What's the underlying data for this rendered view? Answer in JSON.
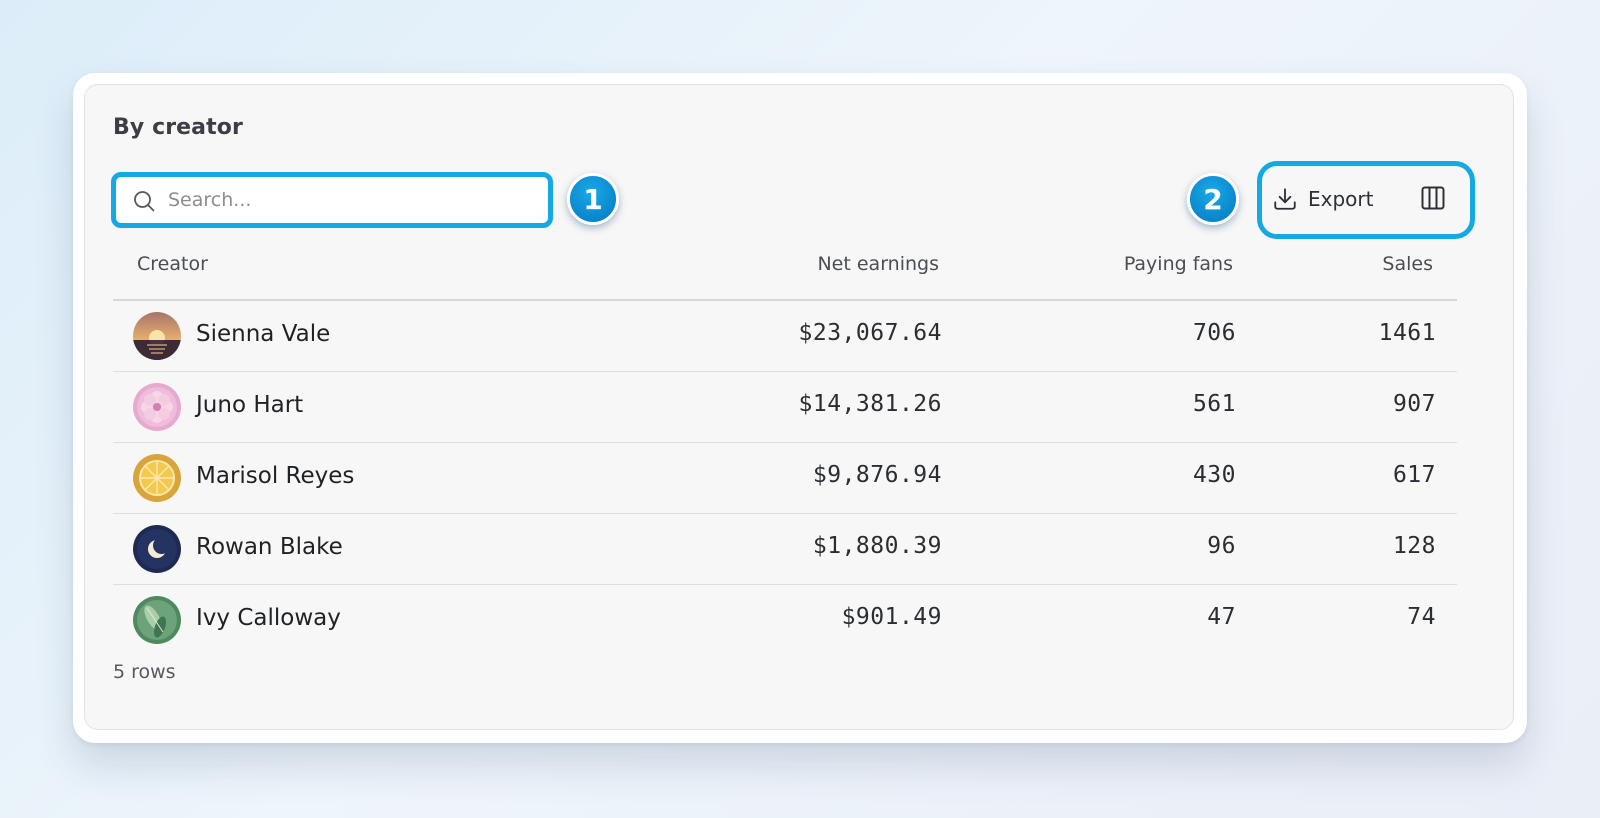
{
  "panel": {
    "title": "By creator",
    "row_count_label": "5 rows"
  },
  "search": {
    "placeholder": "Search...",
    "value": ""
  },
  "toolbar": {
    "export_label": "Export",
    "columns_icon": "columns-icon",
    "export_icon": "download-icon"
  },
  "callouts": {
    "first": "1",
    "second": "2"
  },
  "colors": {
    "highlight": "#15a9e3",
    "callout": "#0a86cc"
  },
  "table": {
    "columns": [
      "Creator",
      "Net earnings",
      "Paying fans",
      "Sales"
    ],
    "rows": [
      {
        "creator": "Sienna Vale",
        "avatar": "sunset-avatar",
        "net_earnings": "$23,067.64",
        "paying_fans": "706",
        "sales": "1461"
      },
      {
        "creator": "Juno Hart",
        "avatar": "flower-avatar",
        "net_earnings": "$14,381.26",
        "paying_fans": "561",
        "sales": "907"
      },
      {
        "creator": "Marisol Reyes",
        "avatar": "citrus-avatar",
        "net_earnings": "$9,876.94",
        "paying_fans": "430",
        "sales": "617"
      },
      {
        "creator": "Rowan Blake",
        "avatar": "moon-avatar",
        "net_earnings": "$1,880.39",
        "paying_fans": "96",
        "sales": "128"
      },
      {
        "creator": "Ivy Calloway",
        "avatar": "leaf-avatar",
        "net_earnings": "$901.49",
        "paying_fans": "47",
        "sales": "74"
      }
    ]
  }
}
